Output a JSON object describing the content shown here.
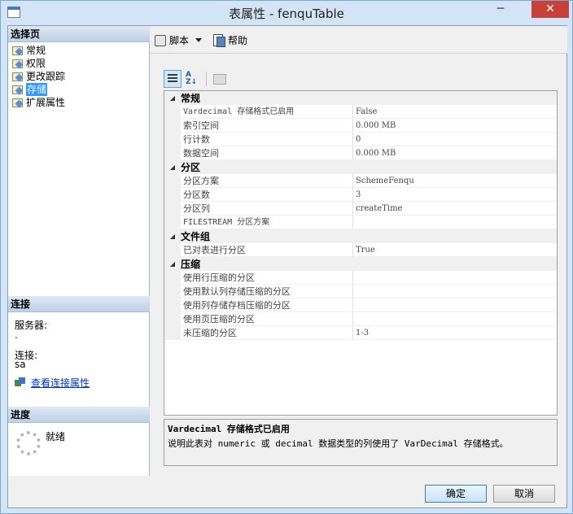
{
  "window": {
    "title": "表属性 - fenquTable",
    "minimize_label": "─",
    "close_label": "✕"
  },
  "left_pane": {
    "select_page_header": "选择页",
    "pages": [
      {
        "label": "常规",
        "icon": "page-icon"
      },
      {
        "label": "权限",
        "icon": "page-icon"
      },
      {
        "label": "更改跟踪",
        "icon": "page-icon"
      },
      {
        "label": "存储",
        "icon": "page-icon",
        "selected": true
      },
      {
        "label": "扩展属性",
        "icon": "page-icon"
      }
    ],
    "connection_header": "连接",
    "server_label": "服务器:",
    "server_value": ".",
    "connection_label": "连接:",
    "connection_value": "sa",
    "view_connection_link": "查看连接属性",
    "progress_header": "进度",
    "progress_status": "就绪"
  },
  "toolbar": {
    "script_label": "脚本",
    "help_label": "帮助"
  },
  "property_grid": {
    "categories": [
      {
        "name": "常规",
        "rows": [
          {
            "name": "Vardecimal 存储格式已启用",
            "value": "False"
          },
          {
            "name": "索引空间",
            "value": "0.000 MB"
          },
          {
            "name": "行计数",
            "value": "0"
          },
          {
            "name": "数据空间",
            "value": "0.000 MB"
          }
        ]
      },
      {
        "name": "分区",
        "rows": [
          {
            "name": "分区方案",
            "value": "SchemeFenqu"
          },
          {
            "name": "分区数",
            "value": "3"
          },
          {
            "name": "分区列",
            "value": "createTime"
          },
          {
            "name": "FILESTREAM 分区方案",
            "value": ""
          }
        ]
      },
      {
        "name": "文件组",
        "rows": [
          {
            "name": "已对表进行分区",
            "value": "True"
          }
        ]
      },
      {
        "name": "压缩",
        "rows": [
          {
            "name": "使用行压缩的分区",
            "value": ""
          },
          {
            "name": "使用默认列存储压缩的分区",
            "value": ""
          },
          {
            "name": "使用列存储存档压缩的分区",
            "value": ""
          },
          {
            "name": "使用页压缩的分区",
            "value": ""
          },
          {
            "name": "未压缩的分区",
            "value": "1-3"
          }
        ]
      }
    ]
  },
  "description": {
    "title": "Vardecimal 存储格式已启用",
    "text": "说明此表对 numeric 或 decimal 数据类型的列使用了 VarDecimal 存储格式。"
  },
  "buttons": {
    "ok": "确定",
    "cancel": "取消"
  }
}
